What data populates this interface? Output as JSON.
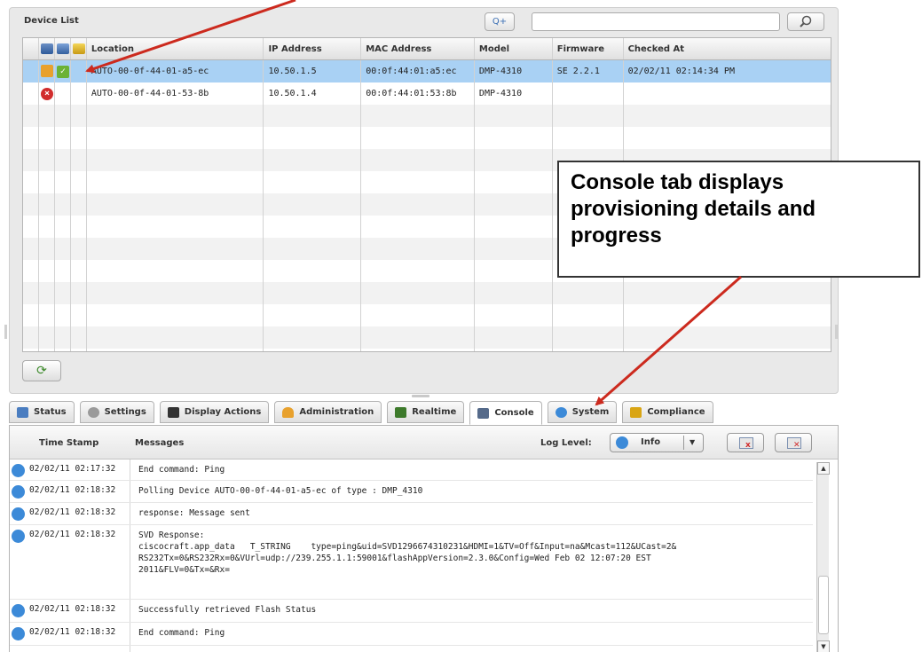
{
  "device_list": {
    "title": "Device List",
    "search_add_label": "Q+",
    "search_placeholder": "",
    "columns": [
      "Location",
      "IP Address",
      "MAC Address",
      "Model",
      "Firmware",
      "Checked At"
    ],
    "rows": [
      {
        "location": "AUTO-00-0f-44-01-a5-ec",
        "ip": "10.50.1.5",
        "mac": "00:0f:44:01:a5:ec",
        "model": "DMP-4310",
        "firmware": "SE 2.2.1",
        "checked_at": "02/02/11 02:14:34 PM",
        "state": "ok"
      },
      {
        "location": "AUTO-00-0f-44-01-53-8b",
        "ip": "10.50.1.4",
        "mac": "00:0f:44:01:53:8b",
        "model": "DMP-4310",
        "firmware": "",
        "checked_at": "",
        "state": "error"
      }
    ],
    "header_icons": [
      "network-icon",
      "monitor-icon",
      "tag-icon"
    ],
    "refresh_icon": "refresh-icon"
  },
  "tabs": [
    {
      "label": "Status",
      "icon": "status-icon",
      "color": "#4a7dc0"
    },
    {
      "label": "Settings",
      "icon": "gear-icon",
      "color": "#9a9a9a"
    },
    {
      "label": "Display Actions",
      "icon": "film-icon",
      "color": "#333333"
    },
    {
      "label": "Administration",
      "icon": "user-icon",
      "color": "#e8a12d"
    },
    {
      "label": "Realtime",
      "icon": "realtime-icon",
      "color": "#3d7a2b"
    },
    {
      "label": "Console",
      "icon": "console-icon",
      "color": "#556a8a",
      "active": true
    },
    {
      "label": "System",
      "icon": "system-icon",
      "color": "#3c8ad8"
    },
    {
      "label": "Compliance",
      "icon": "pencil-icon",
      "color": "#d9a514"
    }
  ],
  "console": {
    "col_time": "Time Stamp",
    "col_messages": "Messages",
    "log_level_label": "Log Level:",
    "log_level_value": "Info",
    "entries": [
      {
        "time": "02/02/11 02:17:32",
        "message": "End command: Ping"
      },
      {
        "time": "02/02/11 02:18:32",
        "message": "Polling Device AUTO-00-0f-44-01-a5-ec of type : DMP_4310"
      },
      {
        "time": "02/02/11 02:18:32",
        "message": "response: Message sent"
      },
      {
        "time": "02/02/11 02:18:32",
        "message": "SVD Response:\nciscocraft.app_data   T_STRING    type=ping&uid=SVD1296674310231&HDMI=1&TV=Off&Input=na&Mcast=112&UCast=2&\nRS232Tx=0&RS232Rx=0&VUrl=udp://239.255.1.1:59001&flashAppVersion=2.3.0&Config=Wed Feb 02 12:07:20 EST\n2011&FLV=0&Tx=&Rx="
      },
      {
        "time": "02/02/11 02:18:32",
        "message": "Successfully retrieved Flash Status"
      },
      {
        "time": "02/02/11 02:18:32",
        "message": "End command: Ping"
      }
    ]
  },
  "annotation": {
    "text": "Console tab displays provisioning details and progress",
    "arrow_color": "#cc2a1e"
  }
}
